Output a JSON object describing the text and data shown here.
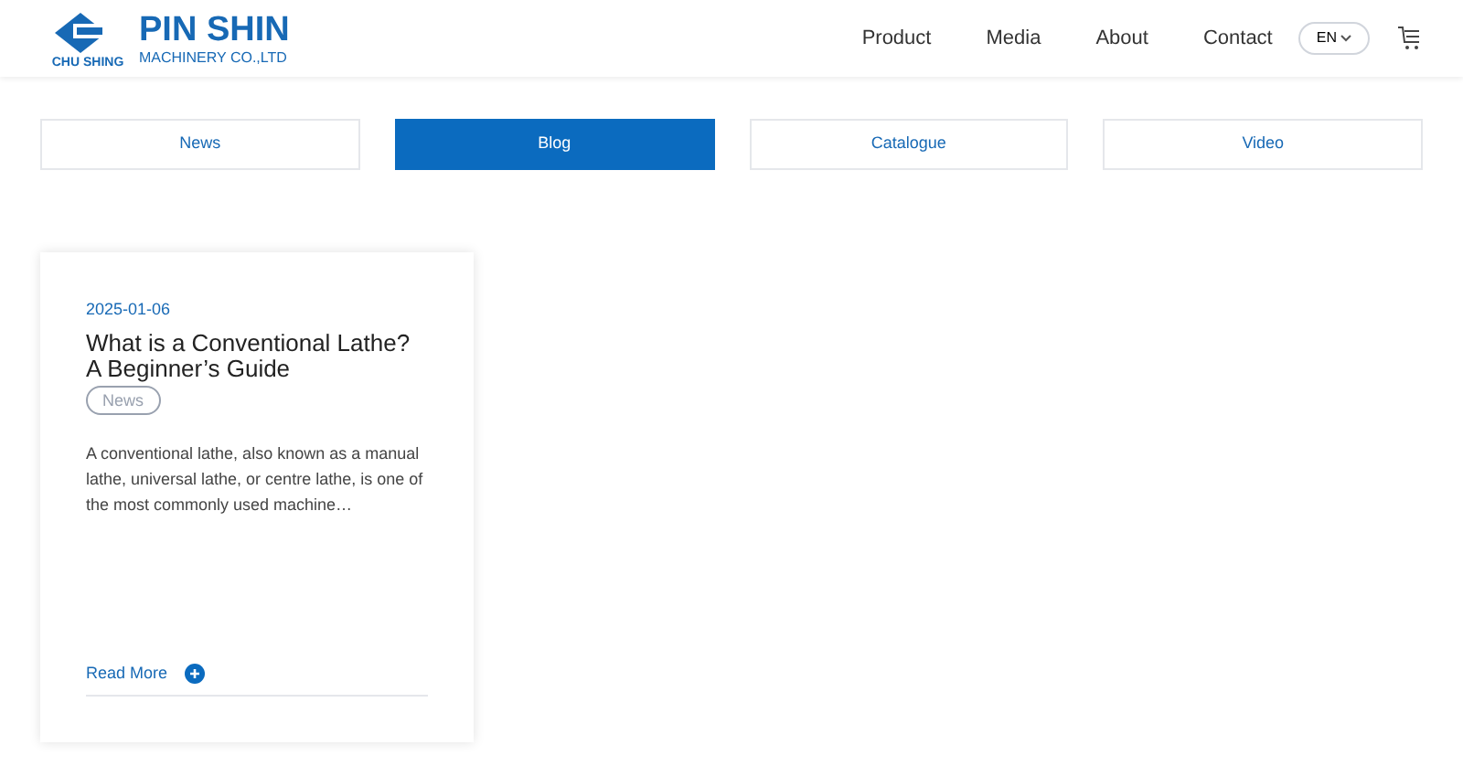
{
  "header": {
    "logo_caption": "CHU SHING",
    "brand": "PIN SHIN",
    "brand_sub": "MACHINERY CO.,LTD",
    "nav": [
      "Product",
      "Media",
      "About",
      "Contact"
    ],
    "language": "EN"
  },
  "tabs": [
    {
      "label": "News",
      "selected": false
    },
    {
      "label": "Blog",
      "selected": true
    },
    {
      "label": "Catalogue",
      "selected": false
    },
    {
      "label": "Video",
      "selected": false
    }
  ],
  "posts": [
    {
      "date": "2025-01-06",
      "title": "What is a Conventional Lathe? A Beginner’s Guide",
      "tag": "News",
      "excerpt": "A conventional lathe, also known as a manual lathe, universal lathe, or centre lathe, is one of the most commonly used machine…",
      "link": "Read More"
    }
  ]
}
